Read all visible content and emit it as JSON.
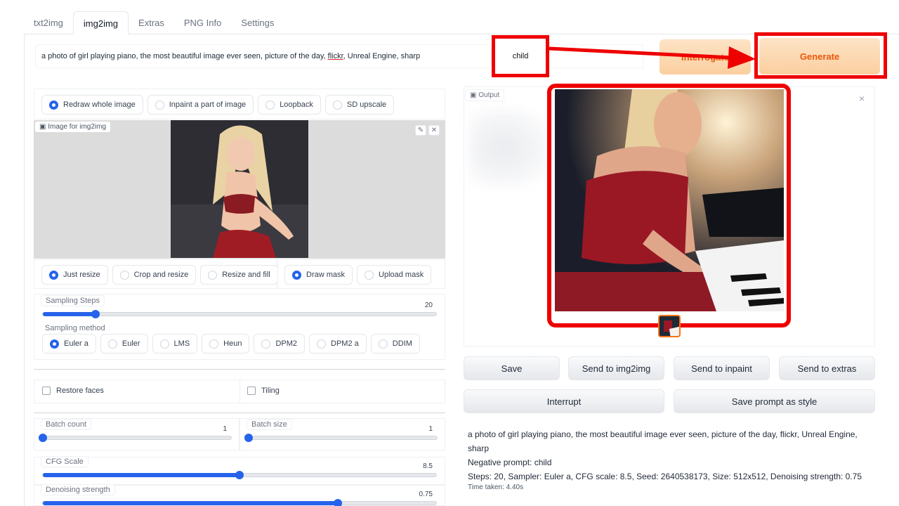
{
  "tabs": [
    "txt2img",
    "img2img",
    "Extras",
    "PNG Info",
    "Settings"
  ],
  "prompt": {
    "before": "a photo of girl playing piano, the most beautiful image ever seen, picture of the day, ",
    "underlined": "flickr",
    "after": ", Unreal Engine, sharp"
  },
  "negative_prompt": "child",
  "buttons": {
    "interrogate": "Interrogate",
    "generate": "Generate"
  },
  "mode_options": [
    "Redraw whole image",
    "Inpaint a part of image",
    "Loopback",
    "SD upscale"
  ],
  "image_label": "Image for img2img",
  "tool_icons": {
    "edit": "✎",
    "close": "✕"
  },
  "resize_options": [
    "Just resize",
    "Crop and resize",
    "Resize and fill"
  ],
  "mask_options": [
    "Draw mask",
    "Upload mask"
  ],
  "sampling_steps": {
    "label": "Sampling Steps",
    "value": "20",
    "fraction": 0.134
  },
  "sampling_method": {
    "label": "Sampling method",
    "options": [
      "Euler a",
      "Euler",
      "LMS",
      "Heun",
      "DPM2",
      "DPM2 a",
      "DDIM"
    ]
  },
  "checkboxes": {
    "restore_faces": "Restore faces",
    "tiling": "Tiling"
  },
  "batch_count": {
    "label": "Batch count",
    "value": "1",
    "fraction": 0.0
  },
  "batch_size": {
    "label": "Batch size",
    "value": "1",
    "fraction": 0.0
  },
  "cfg_scale": {
    "label": "CFG Scale",
    "value": "8.5",
    "fraction": 0.5
  },
  "denoising": {
    "label": "Denoising strength",
    "value": "0.75",
    "fraction": 0.75
  },
  "output": {
    "label": "Output",
    "close": "×",
    "actions": [
      "Save",
      "Send to img2img",
      "Send to inpaint",
      "Send to extras"
    ],
    "interrupt": "Interrupt",
    "save_style": "Save prompt as style"
  },
  "info": {
    "prompt_line": "a photo of girl playing piano, the most beautiful image ever seen, picture of the day, flickr, Unreal Engine, sharp",
    "negative_line": "Negative prompt: child",
    "params_line": "Steps: 20, Sampler: Euler a, CFG scale: 8.5, Seed: 2640538173, Size: 512x512, Denoising strength: 0.75",
    "time_line": "Time taken: 4.40s"
  },
  "colors": {
    "accent": "#2563eb",
    "highlight": "#ef0000",
    "generate_text": "#ea580c"
  }
}
